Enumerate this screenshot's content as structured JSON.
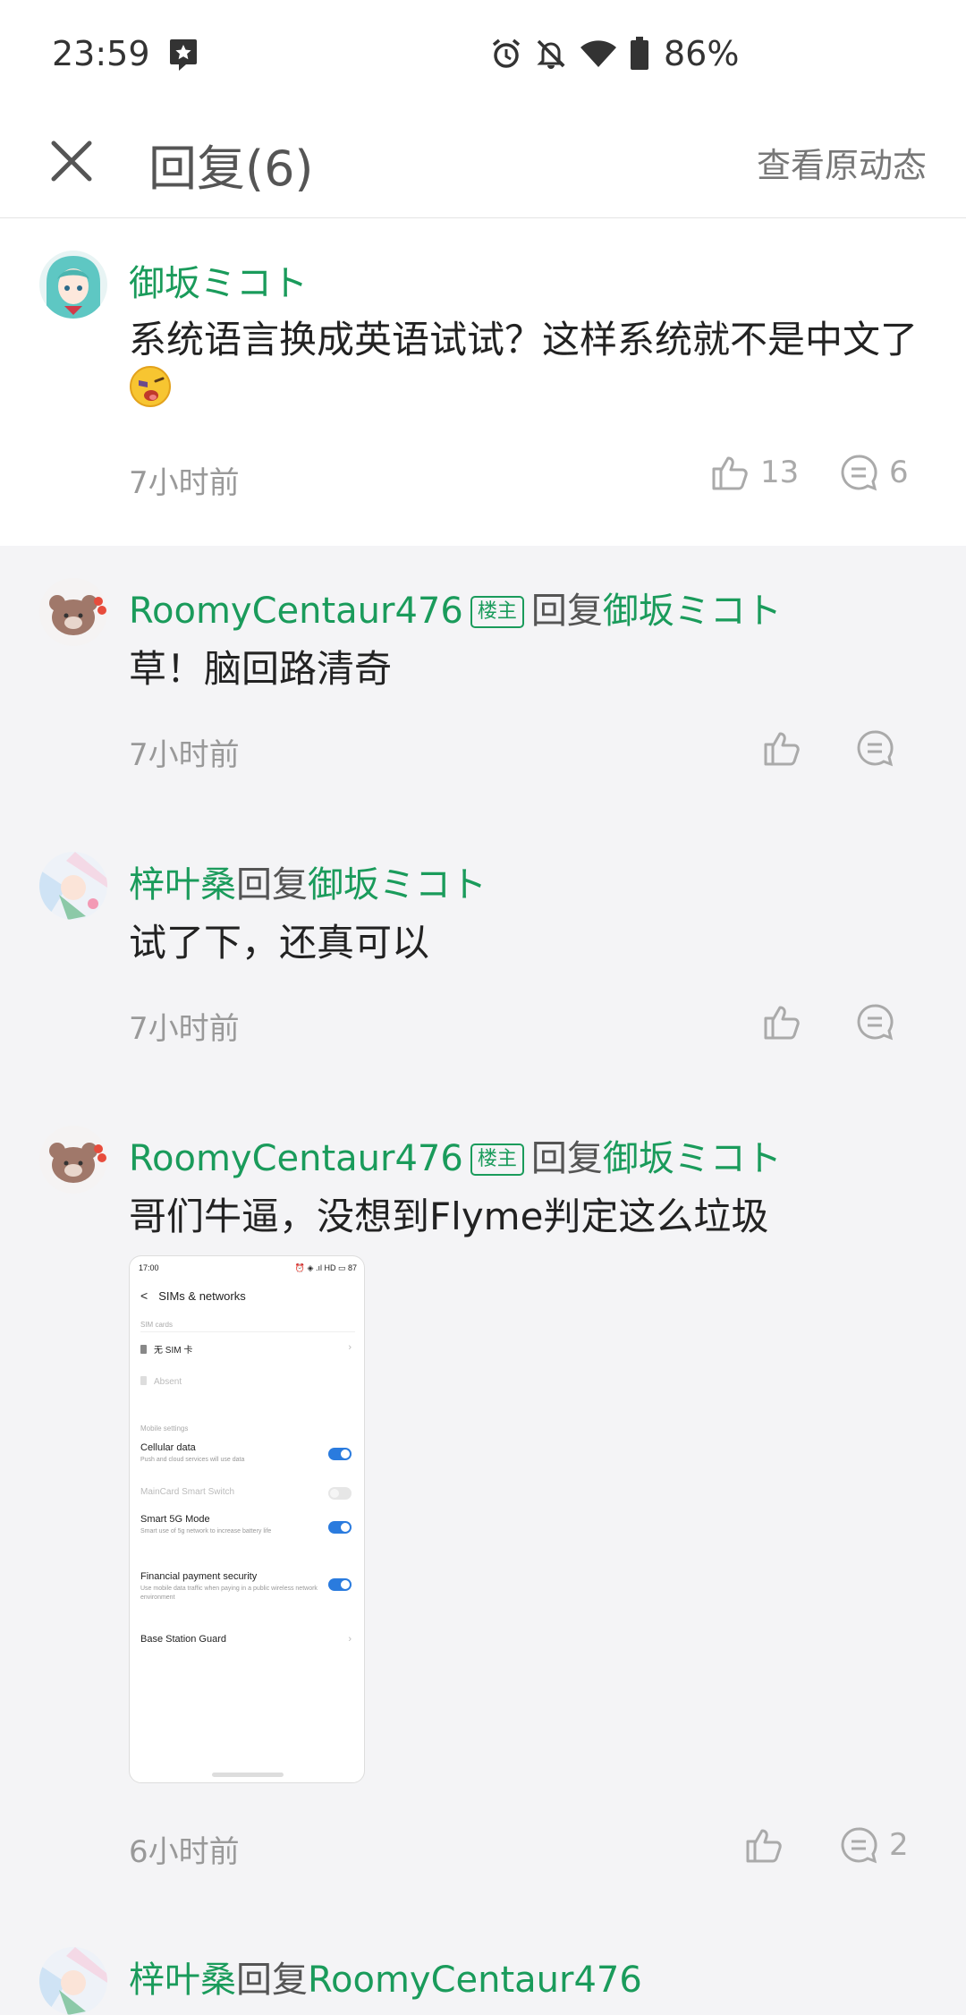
{
  "status": {
    "time": "23:59",
    "battery": "86%"
  },
  "header": {
    "title": "回复(6)",
    "view_original": "查看原动态"
  },
  "main_comment": {
    "user": "御坂ミコト",
    "text": "系统语言换成英语试试？这样系统就不是中文了",
    "emoji": "😜",
    "time": "7小时前",
    "likes": "13",
    "replies": "6"
  },
  "replies": [
    {
      "user": "RoomyCentaur476",
      "badge": "楼主",
      "reply_word": "回复",
      "target": "御坂ミコト",
      "text": "草！脑回路清奇",
      "time": "7小时前"
    },
    {
      "user": "梓叶桑",
      "reply_word": "回复",
      "target": "御坂ミコト",
      "text": "试了下，还真可以",
      "time": "7小时前"
    },
    {
      "user": "RoomyCentaur476",
      "badge": "楼主",
      "reply_word": "回复",
      "target": "御坂ミコト",
      "text": "哥们牛逼，没想到Flyme判定这么垃圾",
      "time": "6小时前",
      "replies": "2"
    },
    {
      "user": "梓叶桑",
      "reply_word": "回复",
      "target": "RoomyCentaur476"
    }
  ],
  "screenshot": {
    "time": "17:00",
    "status_right": "⏰ ◈ .ıl HD ▭ 87",
    "title": "SIMs & networks",
    "sim_cards_label": "SIM cards",
    "sim1": "无 SIM 卡",
    "sim2": "Absent",
    "mobile_settings_label": "Mobile settings",
    "cellular_title": "Cellular data",
    "cellular_sub": "Push and cloud services will use data",
    "maincard": "MainCard Smart Switch",
    "smart5g_title": "Smart 5G Mode",
    "smart5g_sub": "Smart use of 5g network to increase battery life",
    "fin_title": "Financial payment security",
    "fin_sub": "Use mobile data traffic when paying in a public wireless network environment",
    "base_station": "Base Station Guard"
  },
  "colors": {
    "accent_green": "#1a9b5b",
    "toggle_blue": "#2a7bde"
  }
}
